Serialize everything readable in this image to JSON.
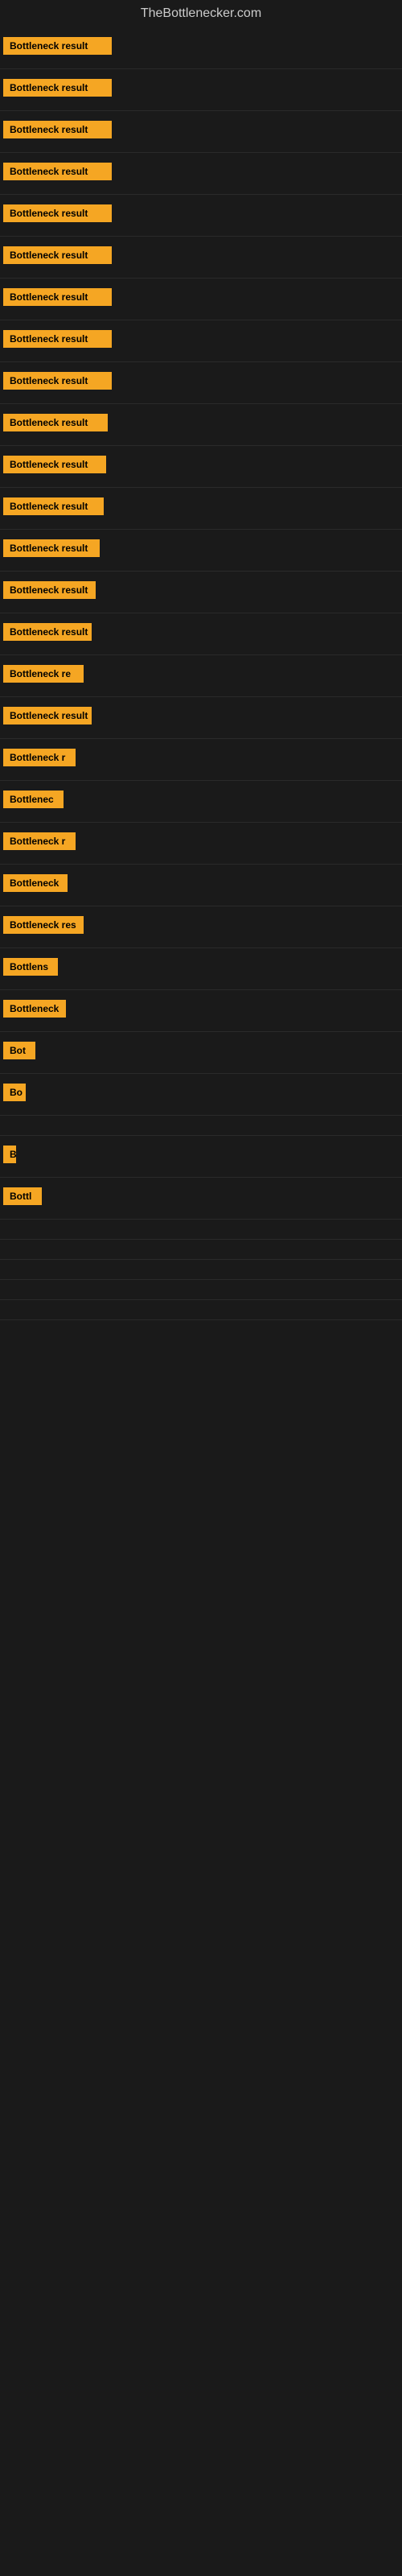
{
  "site": {
    "title": "TheBottlenecker.com"
  },
  "rows": [
    {
      "id": 1,
      "label": "Bottleneck result",
      "width": 135
    },
    {
      "id": 2,
      "label": "Bottleneck result",
      "width": 135
    },
    {
      "id": 3,
      "label": "Bottleneck result",
      "width": 135
    },
    {
      "id": 4,
      "label": "Bottleneck result",
      "width": 135
    },
    {
      "id": 5,
      "label": "Bottleneck result",
      "width": 135
    },
    {
      "id": 6,
      "label": "Bottleneck result",
      "width": 135
    },
    {
      "id": 7,
      "label": "Bottleneck result",
      "width": 135
    },
    {
      "id": 8,
      "label": "Bottleneck result",
      "width": 135
    },
    {
      "id": 9,
      "label": "Bottleneck result",
      "width": 135
    },
    {
      "id": 10,
      "label": "Bottleneck result",
      "width": 130
    },
    {
      "id": 11,
      "label": "Bottleneck result",
      "width": 128
    },
    {
      "id": 12,
      "label": "Bottleneck result",
      "width": 125
    },
    {
      "id": 13,
      "label": "Bottleneck result",
      "width": 120
    },
    {
      "id": 14,
      "label": "Bottleneck result",
      "width": 115
    },
    {
      "id": 15,
      "label": "Bottleneck result",
      "width": 110
    },
    {
      "id": 16,
      "label": "Bottleneck re",
      "width": 100
    },
    {
      "id": 17,
      "label": "Bottleneck result",
      "width": 110
    },
    {
      "id": 18,
      "label": "Bottleneck r",
      "width": 90
    },
    {
      "id": 19,
      "label": "Bottlenec",
      "width": 75
    },
    {
      "id": 20,
      "label": "Bottleneck r",
      "width": 90
    },
    {
      "id": 21,
      "label": "Bottleneck",
      "width": 80
    },
    {
      "id": 22,
      "label": "Bottleneck res",
      "width": 100
    },
    {
      "id": 23,
      "label": "Bottlens",
      "width": 68
    },
    {
      "id": 24,
      "label": "Bottleneck",
      "width": 78
    },
    {
      "id": 25,
      "label": "Bot",
      "width": 40
    },
    {
      "id": 26,
      "label": "Bo",
      "width": 28
    },
    {
      "id": 27,
      "label": "",
      "width": 0
    },
    {
      "id": 28,
      "label": "B",
      "width": 14
    },
    {
      "id": 29,
      "label": "Bottl",
      "width": 48
    },
    {
      "id": 30,
      "label": "",
      "width": 0
    },
    {
      "id": 31,
      "label": "",
      "width": 0
    },
    {
      "id": 32,
      "label": "",
      "width": 0
    },
    {
      "id": 33,
      "label": "",
      "width": 0
    },
    {
      "id": 34,
      "label": "",
      "width": 0
    }
  ]
}
